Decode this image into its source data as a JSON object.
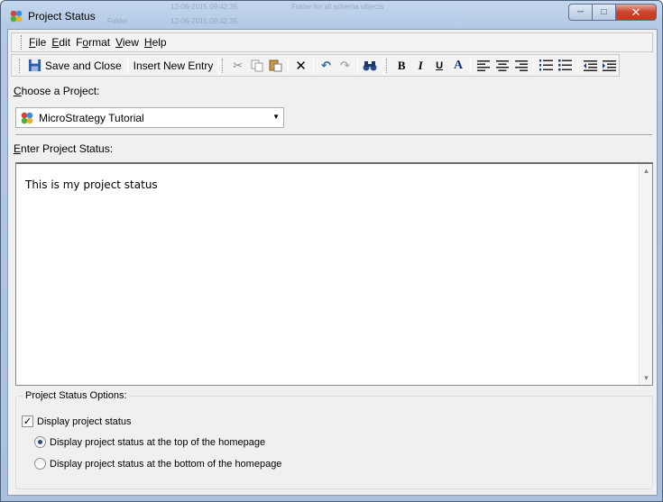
{
  "window": {
    "title": "Project Status",
    "background_ghost_texts": [
      "12-06-2015 09:42:35",
      "Folder for all schema objects",
      "Folder",
      "12-06-2015 09:42:35"
    ]
  },
  "menu": [
    {
      "label": "File"
    },
    {
      "label": "Edit"
    },
    {
      "label": "Format"
    },
    {
      "label": "View"
    },
    {
      "label": "Help"
    }
  ],
  "toolbar": {
    "save_close_label": "Save and Close",
    "insert_entry_label": "Insert New Entry",
    "bold_label": "B",
    "italic_label": "I",
    "underline_label": "U",
    "font_color_label": "A"
  },
  "project": {
    "label": "Choose a Project:",
    "selected": "MicroStrategy Tutorial"
  },
  "status": {
    "label": "Enter Project Status:",
    "text": "This is my project status"
  },
  "options": {
    "legend": "Project Status Options:",
    "display_label": "Display project status",
    "display_checked": true,
    "top_label": "Display project status at the top of the homepage",
    "bottom_label": "Display project status at the bottom of the homepage",
    "selected_position": "top"
  },
  "colors": {
    "close_button": "#c9432b",
    "title_gradient": "#b3c9e4",
    "client_bg": "#f0f0f0"
  }
}
